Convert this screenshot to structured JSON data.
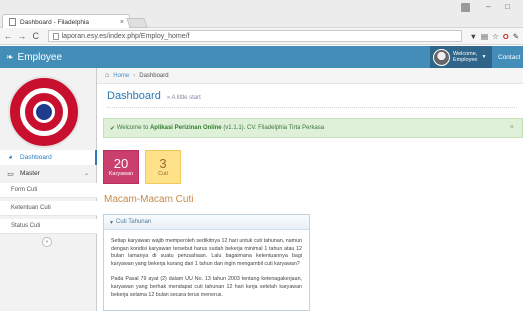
{
  "browser": {
    "tab_title": "Dashboard - Filadelphia",
    "tab_close": "×",
    "url": "laporan.esy.es/index.php/Employ_home/f",
    "minimize": "–",
    "maximize": "□"
  },
  "header": {
    "brand": "Employee",
    "welcome_line1": "Welcome,",
    "welcome_line2": "Employee",
    "contact": "Contact"
  },
  "sidebar": {
    "items": [
      {
        "label": "Dashboard"
      },
      {
        "label": "Master"
      }
    ],
    "subitems": [
      {
        "label": "Form Cuti"
      },
      {
        "label": "Ketentuan Cuti"
      },
      {
        "label": "Status Cuti"
      }
    ]
  },
  "breadcrumb": {
    "home": "Home",
    "current": "Dashboard"
  },
  "page": {
    "title": "Dashboard",
    "subtitle": "» A little start"
  },
  "alert": {
    "prefix": "Welcome to",
    "app_name": "Aplikasi Perizinan Online",
    "version": "(v1.1.1)",
    "suffix": ". CV. Filadelphia Tirta Perkasa",
    "close": "×"
  },
  "stats": [
    {
      "value": "20",
      "label": "Karyawan"
    },
    {
      "value": "3",
      "label": "Cuti"
    }
  ],
  "section": {
    "title": "Macam-Macam Cuti",
    "panel_title": "Cuti Tahunan",
    "paragraphs": [
      "Setiap karyawan wajib memperoleh sedikitnya 12 hari untuk cuti tahunan, namun dengan kondisi karyawan tersebut harus sudah bekerja minimal 1 tahun atau 12 bulan lamanya di suatu perusahaan. Lalu bagaimana ketentuannya bagi karyawan yang bekerja kurang dari 1 tahun dan ingin mengambil cuti karyawan?",
      "Pada Pasal 79 ayat (2) dalam UU No. 13 tahun 2003 tentang ketenagakerjaan, karyawan yang berhak mendapat cuti tahunan 12 hari kerja setelah karyawan bekerja selama 12 bulan secara terus menerus."
    ]
  }
}
